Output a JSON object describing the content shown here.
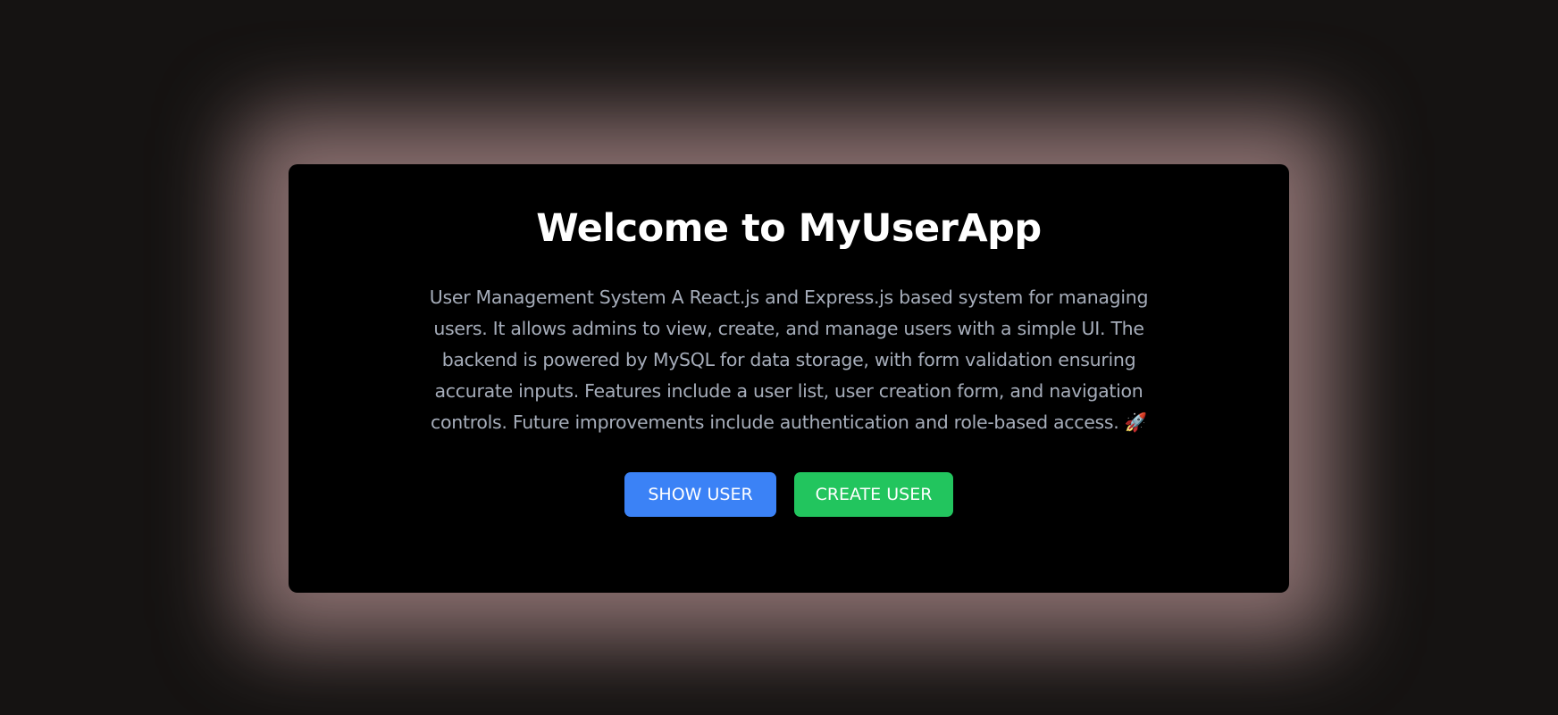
{
  "page": {
    "title": "Welcome to MyUserApp",
    "description": "User Management System A React.js and Express.js based system for managing users. It allows admins to view, create, and manage users with a simple UI. The backend is powered by MySQL for data storage, with form validation ensuring accurate inputs. Features include a user list, user creation form, and navigation controls. Future improvements include authentication and role-based access. 🚀"
  },
  "actions": {
    "show_user_label": "SHOW USER",
    "create_user_label": "CREATE USER"
  },
  "colors": {
    "background": "#151312",
    "card": "#000000",
    "glow": "#8e7373",
    "title": "#ffffff",
    "description": "#a6adba",
    "show_user_button": "#3b82f6",
    "create_user_button": "#22c55e"
  }
}
